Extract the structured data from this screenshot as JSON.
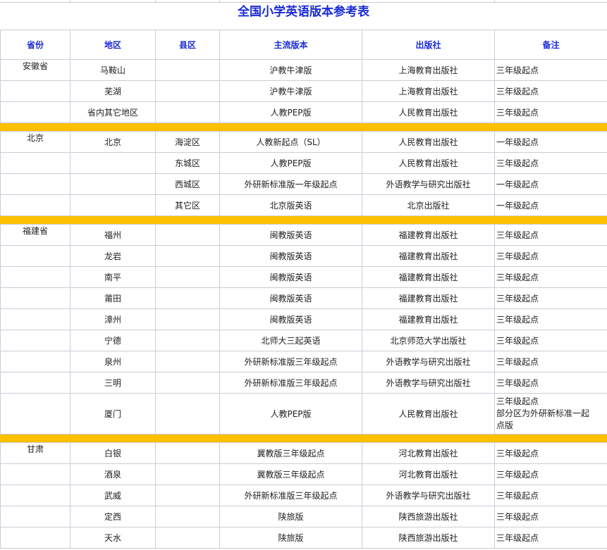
{
  "title": "全国小学英语版本参考表",
  "headers": {
    "province": "省份",
    "region": "地区",
    "county": "县区",
    "edition": "主流版本",
    "publisher": "出版社",
    "note": "备注"
  },
  "groups": [
    {
      "province": "安徽省",
      "rows": [
        {
          "region": "马鞍山",
          "county": "",
          "edition": "沪教牛津版",
          "publisher": "上海教育出版社",
          "note": "三年级起点"
        },
        {
          "region": "芜湖",
          "county": "",
          "edition": "沪教牛津版",
          "publisher": "上海教育出版社",
          "note": "三年级起点"
        },
        {
          "region": "省内其它地区",
          "county": "",
          "edition": "人教PEP版",
          "publisher": "人民教育出版社",
          "note": "三年级起点"
        }
      ]
    },
    {
      "province": "北京",
      "rows": [
        {
          "region": "北京",
          "county": "海淀区",
          "edition": "人教新起点（SL）",
          "publisher": "人民教育出版社",
          "note": "一年级起点"
        },
        {
          "region": "",
          "county": "东城区",
          "edition": "人教PEP版",
          "publisher": "人民教育出版社",
          "note": "三年级起点"
        },
        {
          "region": "",
          "county": "西城区",
          "edition": "外研新标准版一年级起点",
          "publisher": "外语教学与研究出版社",
          "note": "一年级起点"
        },
        {
          "region": "",
          "county": "其它区",
          "edition": "北京版英语",
          "publisher": "北京出版社",
          "note": "一年级起点"
        }
      ]
    },
    {
      "province": "福建省",
      "rows": [
        {
          "region": "福州",
          "county": "",
          "edition": "闽教版英语",
          "publisher": "福建教育出版社",
          "note": "三年级起点"
        },
        {
          "region": "龙岩",
          "county": "",
          "edition": "闽教版英语",
          "publisher": "福建教育出版社",
          "note": "三年级起点"
        },
        {
          "region": "南平",
          "county": "",
          "edition": "闽教版英语",
          "publisher": "福建教育出版社",
          "note": "三年级起点"
        },
        {
          "region": "莆田",
          "county": "",
          "edition": "闽教版英语",
          "publisher": "福建教育出版社",
          "note": "三年级起点"
        },
        {
          "region": "漳州",
          "county": "",
          "edition": "闽教版英语",
          "publisher": "福建教育出版社",
          "note": "三年级起点"
        },
        {
          "region": "宁德",
          "county": "",
          "edition": "北师大三起英语",
          "publisher": "北京师范大学出版社",
          "note": "三年级起点"
        },
        {
          "region": "泉州",
          "county": "",
          "edition": "外研新标准版三年级起点",
          "publisher": "外语教学与研究出版社",
          "note": "三年级起点"
        },
        {
          "region": "三明",
          "county": "",
          "edition": "外研新标准版三年级起点",
          "publisher": "外语教学与研究出版社",
          "note": "三年级起点"
        },
        {
          "region": "厦门",
          "county": "",
          "edition": "人教PEP版",
          "publisher": "人民教育出版社",
          "note": "三年级起点",
          "note_lines": [
            "部分区为外研新标准一起",
            "点版"
          ]
        }
      ]
    },
    {
      "province": "甘肃",
      "rows": [
        {
          "region": "白银",
          "county": "",
          "edition": "冀教版三年级起点",
          "publisher": "河北教育出版社",
          "note": "三年级起点"
        },
        {
          "region": "酒泉",
          "county": "",
          "edition": "冀教版三年级起点",
          "publisher": "河北教育出版社",
          "note": "三年级起点"
        },
        {
          "region": "武威",
          "county": "",
          "edition": "外研新标准版三年级起点",
          "publisher": "外语教学与研究出版社",
          "note": "三年级起点"
        },
        {
          "region": "定西",
          "county": "",
          "edition": "陕旅版",
          "publisher": "陕西旅游出版社",
          "note": "三年级起点"
        },
        {
          "region": "天水",
          "county": "",
          "edition": "陕旅版",
          "publisher": "陕西旅游出版社",
          "note": "三年级起点"
        }
      ]
    }
  ],
  "colors": {
    "title": "#1a2bd8",
    "header": "#1a2bd8",
    "separator": "#ffc000",
    "grid": "#c8cdd6"
  }
}
